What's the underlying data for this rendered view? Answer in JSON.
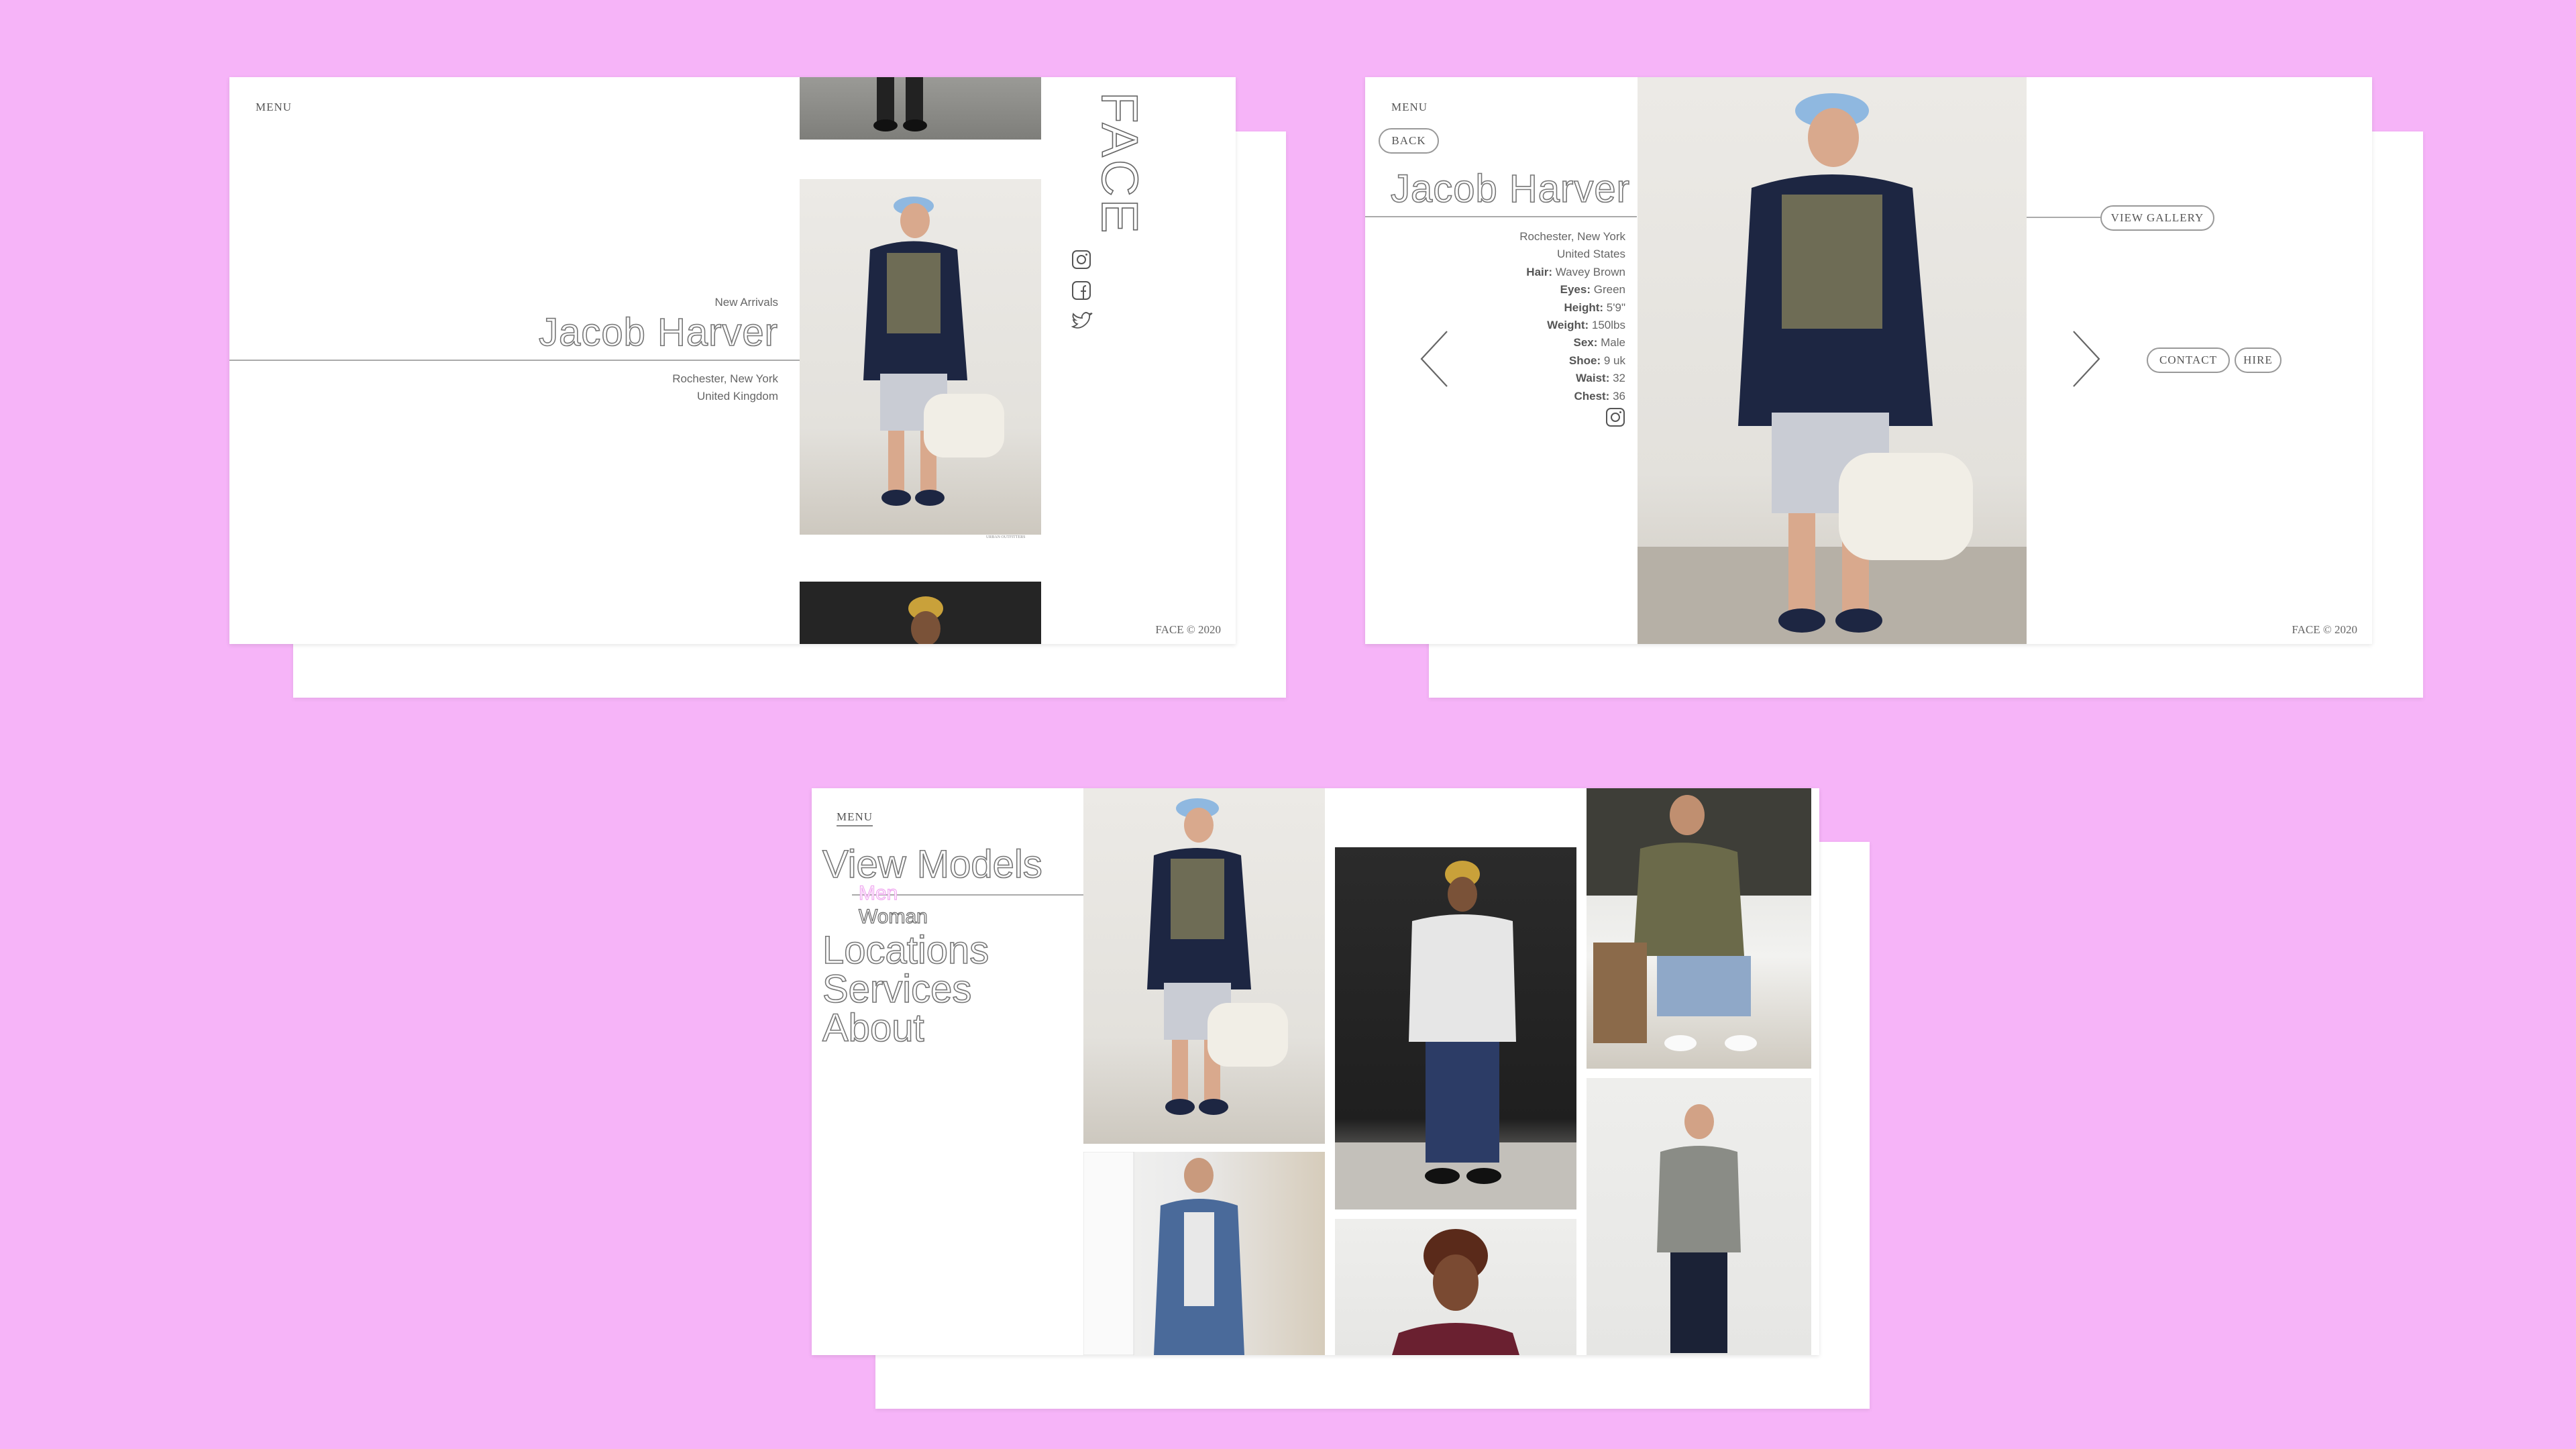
{
  "colors": {
    "background": "#f6b4f8",
    "accent": "#f0a8f0"
  },
  "panel1": {
    "menu": "MENU",
    "section": "New Arrivals",
    "name": "Jacob Harver",
    "location_line1": "Rochester, New York",
    "location_line2": "United Kingdom",
    "brand": "FACE",
    "caption": "URBAN OUTFITTERS",
    "footer": "FACE © 2020",
    "icons": [
      "instagram-icon",
      "facebook-icon",
      "twitter-icon"
    ]
  },
  "panel2": {
    "menu": "MENU",
    "back": "BACK",
    "name": "Jacob Harver",
    "location_line1": "Rochester, New York",
    "location_line2": "United States",
    "stats": [
      {
        "label": "Hair:",
        "value": " Wavey Brown"
      },
      {
        "label": "Eyes:",
        "value": " Green"
      },
      {
        "label": "Height:",
        "value": " 5'9\""
      },
      {
        "label": "Weight:",
        "value": " 150lbs"
      },
      {
        "label": "Sex:",
        "value": " Male"
      },
      {
        "label": "Shoe:",
        "value": " 9 uk"
      },
      {
        "label": "Waist:",
        "value": " 32"
      },
      {
        "label": "Chest:",
        "value": " 36"
      }
    ],
    "view_gallery": "VIEW GALLERY",
    "contact": "CONTACT",
    "hire": "HIRE",
    "footer": "FACE © 2020"
  },
  "panel3": {
    "menu": "MENU",
    "nav": {
      "view_models": "View Models",
      "men": "Men",
      "woman": "Woman",
      "locations": "Locations",
      "services": "Services",
      "about": "About"
    }
  }
}
